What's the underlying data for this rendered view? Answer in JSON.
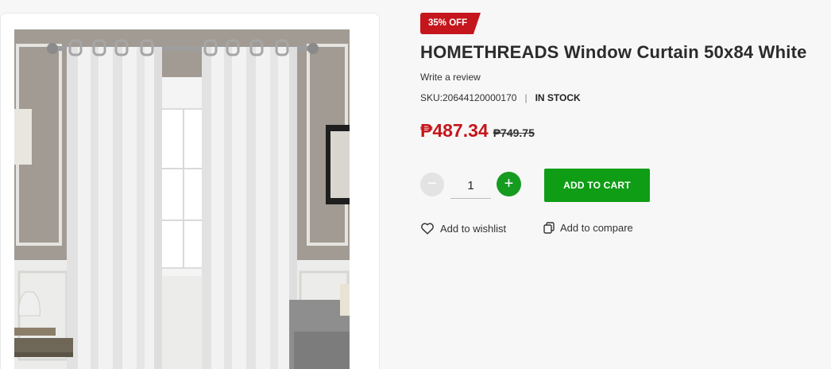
{
  "product": {
    "discount_badge": "35% OFF",
    "title": "HOMETHREADS Window Curtain 50x84 White",
    "write_review": "Write a review",
    "sku": "SKU:20644120000170",
    "meta_separator": "|",
    "stock_status": "IN STOCK",
    "sale_price": "₱487.34",
    "original_price": "₱749.75",
    "image_alt": "White window curtain panels hanging on a rod in a living room"
  },
  "quantity": {
    "minus_symbol": "−",
    "value": "1",
    "plus_symbol": "+"
  },
  "actions": {
    "add_to_cart": "ADD TO CART",
    "wishlist": "Add to wishlist",
    "compare": "Add to compare"
  },
  "icons": {
    "wishlist": "heart-icon",
    "compare": "copy-icon"
  },
  "colors": {
    "badge_red": "#c4161c",
    "sale_price_red": "#c4161c",
    "cart_green": "#0f9d16",
    "plus_green": "#169b21"
  }
}
